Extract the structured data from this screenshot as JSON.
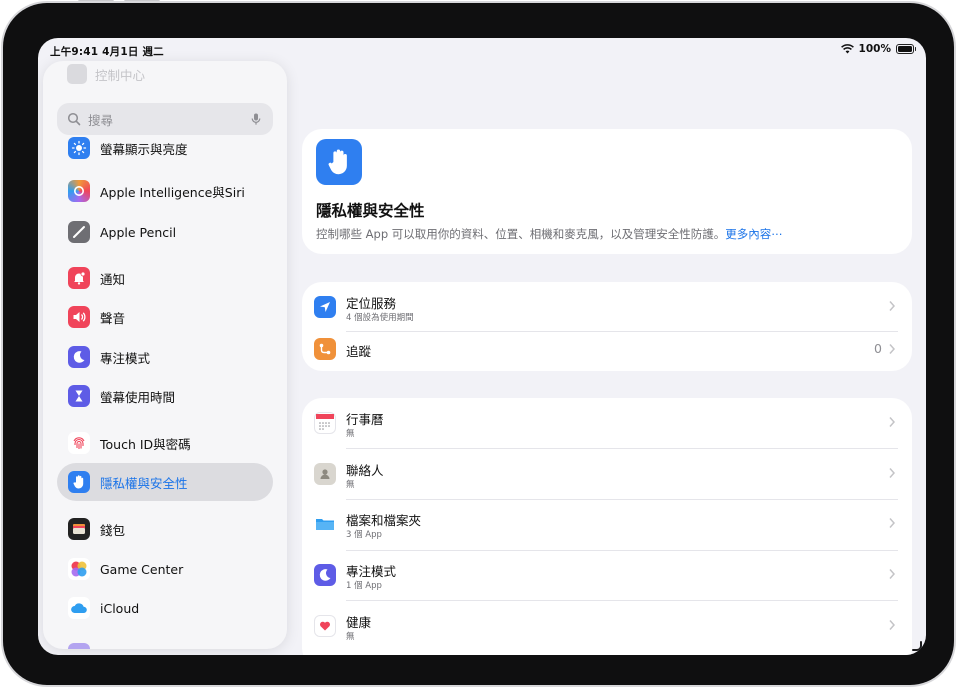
{
  "status_bar": {
    "time_date": "上午9:41   4月1日 週二",
    "battery": "100%"
  },
  "sidebar": {
    "ghost_item": "控制中心",
    "search_placeholder": "搜尋",
    "items": [
      {
        "label": "螢幕顯示與亮度",
        "icon": "sun-icon",
        "color": "#2f7ff0"
      },
      {
        "label": "Apple Intelligence與Siri",
        "icon": "apple-intelligence-icon",
        "color": "#a56af0"
      },
      {
        "label": "Apple Pencil",
        "icon": "pencil-icon",
        "color": "#6e6e73"
      },
      {
        "label": "通知",
        "icon": "bell-icon",
        "color": "#f0445a"
      },
      {
        "label": "聲音",
        "icon": "speaker-icon",
        "color": "#f0445a"
      },
      {
        "label": "專注模式",
        "icon": "moon-icon",
        "color": "#5e5ce6"
      },
      {
        "label": "螢幕使用時間",
        "icon": "hourglass-icon",
        "color": "#5e5ce6"
      },
      {
        "label": "Touch ID與密碼",
        "icon": "fingerprint-icon",
        "color": "#f0445a"
      },
      {
        "label": "隱私權與安全性",
        "icon": "hand-icon",
        "color": "#2f7ff0",
        "selected": true
      },
      {
        "label": "錢包",
        "icon": "wallet-icon",
        "color": "#222222"
      },
      {
        "label": "Game Center",
        "icon": "game-center-icon",
        "color": "#f06a5a"
      },
      {
        "label": "iCloud",
        "icon": "cloud-icon",
        "color": "#2f9ef0"
      }
    ]
  },
  "hero": {
    "title": "隱私權與安全性",
    "description": "控制哪些 App 可以取用你的資料、位置、相機和麥克風，以及管理安全性防護。",
    "more_link": "更多內容⋯"
  },
  "group1": [
    {
      "title": "定位服務",
      "subtitle": "4 個設為使用期間",
      "icon": "location-arrow-icon",
      "color": "#2f7ff0"
    },
    {
      "title": "追蹤",
      "value": "0",
      "icon": "tracking-icon",
      "color": "#f0913a"
    }
  ],
  "group2": [
    {
      "title": "行事曆",
      "subtitle": "無",
      "icon": "calendar-icon"
    },
    {
      "title": "聯絡人",
      "subtitle": "無",
      "icon": "contacts-icon"
    },
    {
      "title": "檔案和檔案夾",
      "subtitle": "3 個 App",
      "icon": "folder-icon"
    },
    {
      "title": "專注模式",
      "subtitle": "1 個 App",
      "icon": "moon-icon"
    },
    {
      "title": "健康",
      "subtitle": "無",
      "icon": "health-heart-icon"
    }
  ]
}
